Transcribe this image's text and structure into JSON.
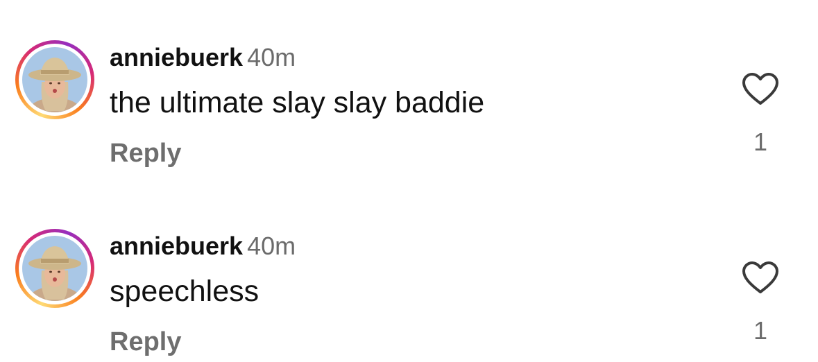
{
  "comments": [
    {
      "username": "anniebuerk",
      "time": "40m",
      "text": "the ultimate slay slay baddie",
      "reply_label": "Reply",
      "like_count": "1",
      "avatar_icon": "user-avatar",
      "like_icon": "heart-outline-icon"
    },
    {
      "username": "anniebuerk",
      "time": "40m",
      "text": "speechless",
      "reply_label": "Reply",
      "like_count": "1",
      "avatar_icon": "user-avatar",
      "like_icon": "heart-outline-icon"
    }
  ],
  "colors": {
    "text": "#111111",
    "secondary": "#6b6b6b",
    "ring_gradient": [
      "#feda75",
      "#fa7e1e",
      "#d62976",
      "#962fbf"
    ]
  }
}
